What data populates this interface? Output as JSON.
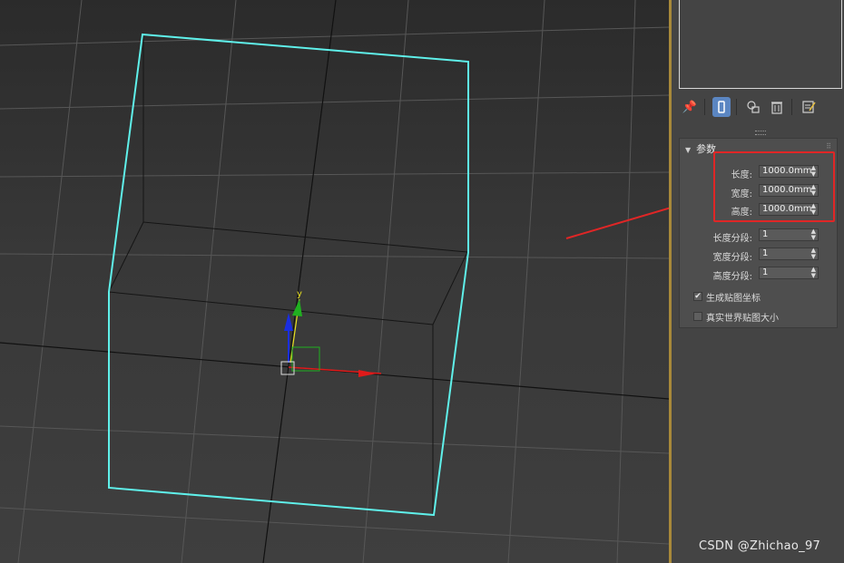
{
  "viewport": {
    "gizmo": {
      "y_label": "y"
    }
  },
  "toolbar": {
    "icons": [
      "pin-icon",
      "modifier-stack-icon",
      "make-unique-icon",
      "remove-modifier-icon",
      "configure-icon"
    ],
    "active": "modifier-stack-icon"
  },
  "rollout": {
    "title": "参数",
    "fields": [
      {
        "label": "长度:",
        "value": "1000.0mm"
      },
      {
        "label": "宽度:",
        "value": "1000.0mm"
      },
      {
        "label": "高度:",
        "value": "1000.0mm"
      }
    ],
    "segments": [
      {
        "label": "长度分段:",
        "value": "1"
      },
      {
        "label": "宽度分段:",
        "value": "1"
      },
      {
        "label": "高度分段:",
        "value": "1"
      }
    ],
    "checkboxes": [
      {
        "label": "生成贴图坐标",
        "checked": true
      },
      {
        "label": "真实世界贴图大小",
        "checked": false
      }
    ]
  },
  "watermark": "CSDN @Zhichao_97",
  "colors": {
    "selection": "#5ff0ea",
    "highlight": "#e02626",
    "axis_x": "#e01a1a",
    "axis_y": "#20b020",
    "axis_z": "#1a2ee0",
    "viewport_border": "#a8893a",
    "active_tool": "#5b86c2"
  }
}
